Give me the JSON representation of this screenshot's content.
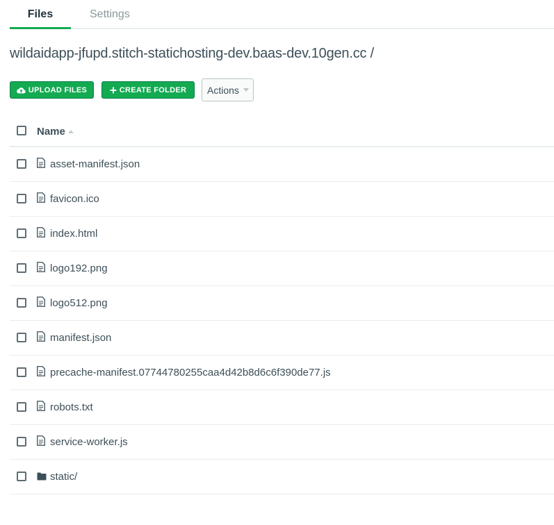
{
  "tabs": {
    "files": "Files",
    "settings": "Settings"
  },
  "path": "wildaidapp-jfupd.stitch-statichosting-dev.baas-dev.10gen.cc /",
  "toolbar": {
    "upload_label": "UPLOAD FILES",
    "create_label": "CREATE FOLDER",
    "actions_label": "Actions"
  },
  "table": {
    "header": "Name",
    "rows": [
      {
        "name": "asset-manifest.json",
        "icon": "file-icon"
      },
      {
        "name": "favicon.ico",
        "icon": "file-icon"
      },
      {
        "name": "index.html",
        "icon": "file-icon"
      },
      {
        "name": "logo192.png",
        "icon": "file-icon"
      },
      {
        "name": "logo512.png",
        "icon": "file-icon"
      },
      {
        "name": "manifest.json",
        "icon": "file-icon"
      },
      {
        "name": "precache-manifest.07744780255caa4d42b8d6c6f390de77.js",
        "icon": "file-icon"
      },
      {
        "name": "robots.txt",
        "icon": "file-icon"
      },
      {
        "name": "service-worker.js",
        "icon": "file-icon"
      },
      {
        "name": "static/",
        "icon": "folder-icon"
      }
    ]
  },
  "colors": {
    "accent": "#13aa52",
    "text": "#3d4f58",
    "border": "#e7eeec"
  }
}
